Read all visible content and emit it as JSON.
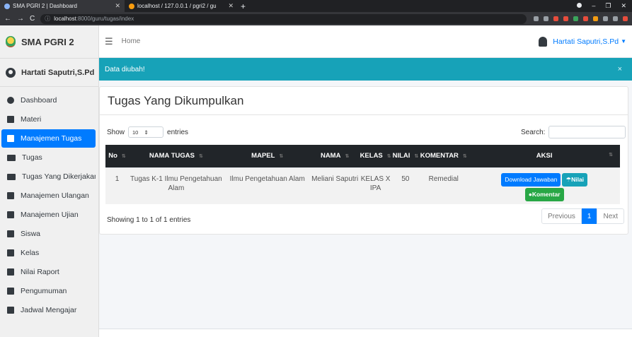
{
  "browser": {
    "tabs": [
      {
        "title": "SMA PGRI 2 | Dashboard"
      },
      {
        "title": "localhost / 127.0.0.1 / pgri2 / gu"
      }
    ],
    "url_host": "localhost",
    "url_path": ":8000/guru/tugas/index"
  },
  "sidebar": {
    "brand": "SMA PGRI 2",
    "user": "Hartati Saputri,S.Pd",
    "items": [
      {
        "label": "Dashboard",
        "icon": "tachometer-icon",
        "active": false
      },
      {
        "label": "Materi",
        "icon": "book-icon",
        "active": false
      },
      {
        "label": "Manajemen Tugas",
        "icon": "book-icon",
        "active": true
      },
      {
        "label": "Tugas",
        "icon": "book-open-icon",
        "active": false
      },
      {
        "label": "Tugas Yang Dikerjakan",
        "icon": "book-open-icon",
        "active": false
      },
      {
        "label": "Manajemen Ulangan",
        "icon": "book-icon",
        "active": false
      },
      {
        "label": "Manajemen Ujian",
        "icon": "book-icon",
        "active": false
      },
      {
        "label": "Siswa",
        "icon": "book-icon",
        "active": false
      },
      {
        "label": "Kelas",
        "icon": "book-icon",
        "active": false
      },
      {
        "label": "Nilai Raport",
        "icon": "book-icon",
        "active": false
      },
      {
        "label": "Pengumuman",
        "icon": "book-icon",
        "active": false
      },
      {
        "label": "Jadwal Mengajar",
        "icon": "book-icon",
        "active": false
      }
    ]
  },
  "navbar": {
    "home": "Home",
    "user": "Hartati Saputri,S.Pd"
  },
  "alert": {
    "text": "Data diubah!",
    "close": "×"
  },
  "card": {
    "title": "Tugas Yang Dikumpulkan",
    "show_label": "Show",
    "entries_value": "10",
    "entries_label": "entries",
    "search_label": "Search:",
    "showing": "Showing 1 to 1 of 1 entries"
  },
  "table": {
    "headers": [
      "No",
      "NAMA TUGAS",
      "MAPEL",
      "NAMA",
      "KELAS",
      "NILAI",
      "KOMENTAR",
      "AKSI"
    ],
    "rows": [
      {
        "no": "1",
        "nama_tugas": "Tugas K-1 Ilmu Pengetahuan Alam",
        "mapel": "Ilmu Pengetahuan Alam",
        "nama": "Meliani Saputri",
        "kelas": "KELAS X IPA",
        "nilai": "50",
        "komentar": "Remedial",
        "btn_download": "Download Jawaban",
        "btn_nilai": "Nilai",
        "btn_komentar": "Komentar"
      }
    ]
  },
  "pagination": {
    "previous": "Previous",
    "current": "1",
    "next": "Next"
  },
  "colors": {
    "primary": "#007bff",
    "info": "#17a2b8",
    "success": "#28a745",
    "table_header": "#212529"
  }
}
